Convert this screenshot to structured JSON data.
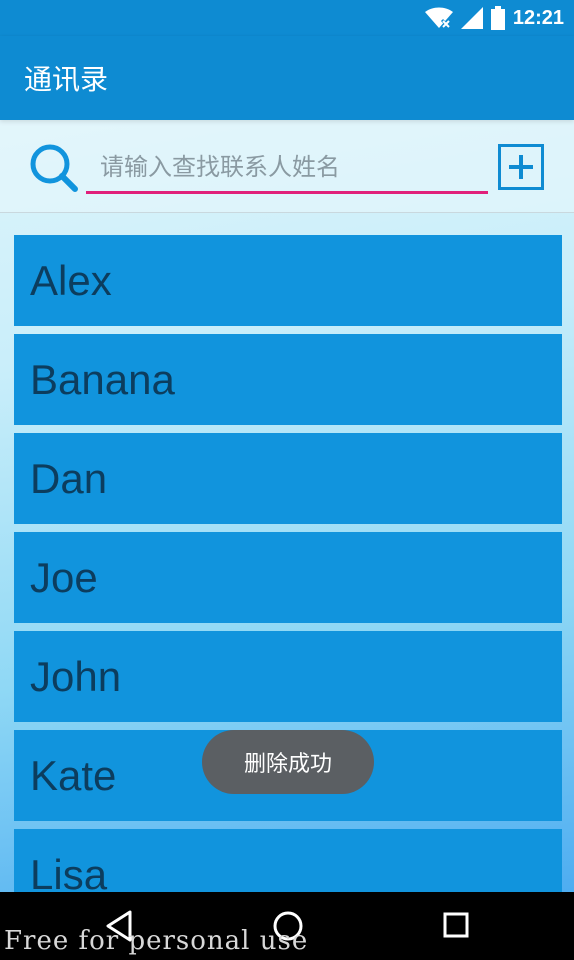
{
  "status_bar": {
    "time": "12:21",
    "icons": [
      "wifi-icon",
      "signal-icon",
      "battery-icon"
    ]
  },
  "app_bar": {
    "title": "通讯录"
  },
  "search": {
    "icon": "search-icon",
    "placeholder": "请输入查找联系人姓名",
    "value": "",
    "add_icon": "plus-icon"
  },
  "contacts": [
    {
      "name": "Alex"
    },
    {
      "name": "Banana"
    },
    {
      "name": "Dan"
    },
    {
      "name": "Joe"
    },
    {
      "name": "John"
    },
    {
      "name": "Kate"
    },
    {
      "name": "Lisa"
    }
  ],
  "toast": {
    "message": "删除成功"
  },
  "nav_bar": {
    "buttons": [
      "back-icon",
      "home-icon",
      "recents-icon"
    ]
  },
  "watermark": "Free for personal use",
  "colors": {
    "primary": "#0e8bd2",
    "list_item": "#1194dd",
    "list_text": "#0c3d5e",
    "accent_underline": "#e0207a",
    "toast_bg": "#5b5f63"
  }
}
